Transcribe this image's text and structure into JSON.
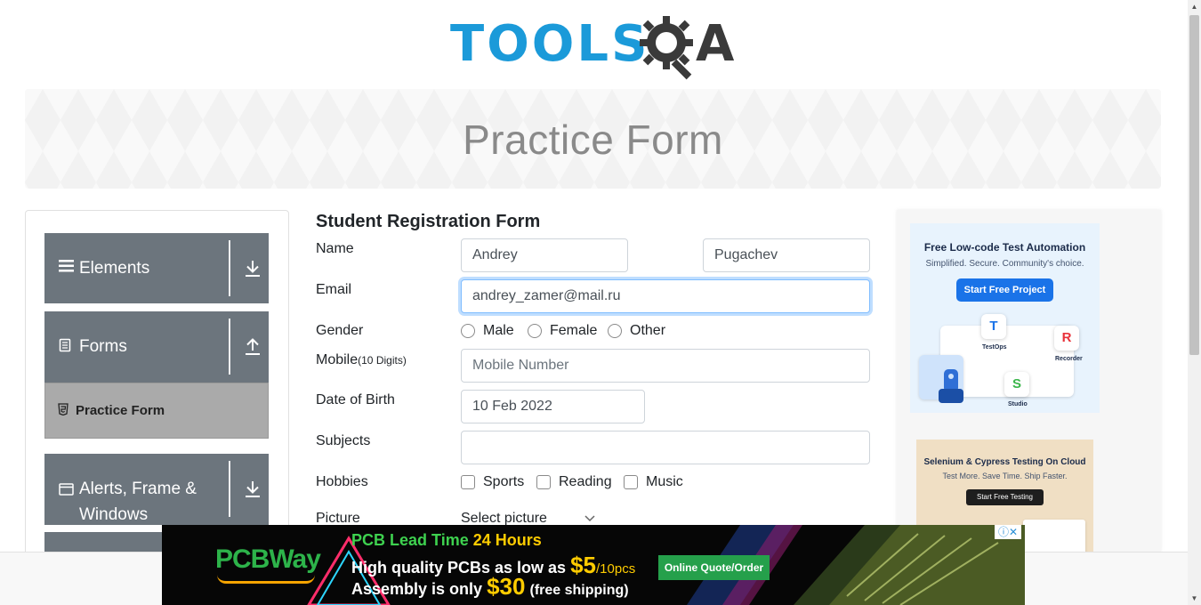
{
  "logo": {
    "text": "TOOLS",
    "suffix": "A",
    "brand_color": "#1b9ad9",
    "accent_color": "#3a3a3a"
  },
  "banner": {
    "title": "Practice Form"
  },
  "sidebar": {
    "groups": [
      {
        "label": "Elements",
        "icon": "hamburger-icon",
        "arrow": "download-icon"
      },
      {
        "label": "Forms",
        "icon": "document-icon",
        "arrow": "upload-icon"
      },
      {
        "label": "Alerts, Frame &",
        "label2": "Windows",
        "icon": "window-icon",
        "arrow": "download-icon"
      }
    ],
    "sub_item": {
      "label": "Practice Form",
      "icon": "html5-icon"
    },
    "group_bg": "#6c757d",
    "active_bg": "#aaaaaa"
  },
  "form": {
    "title": "Student Registration Form",
    "name_label": "Name",
    "first_name": "Andrey",
    "last_name": "Pugachev",
    "email_label": "Email",
    "email": "andrey_zamer@mail.ru",
    "gender_label": "Gender",
    "gender_options": [
      "Male",
      "Female",
      "Other"
    ],
    "mobile_label": "Mobile",
    "mobile_hint": "(10 Digits)",
    "mobile_placeholder": "Mobile Number",
    "dob_label": "Date of Birth",
    "dob": "10 Feb 2022",
    "subjects_label": "Subjects",
    "subjects": "",
    "hobbies_label": "Hobbies",
    "hobbies": [
      "Sports",
      "Reading",
      "Music"
    ],
    "picture_label": "Picture",
    "picture_button": "Select picture"
  },
  "ads": {
    "ad1": {
      "title": "Free Low-code Test Automation",
      "subtitle": "Simplified. Secure. Community's choice.",
      "button": "Start Free Project",
      "tiles": [
        "TestOps",
        "Recorder",
        "Studio"
      ]
    },
    "ad2": {
      "title": "Selenium & Cypress Testing On Cloud",
      "subtitle": "Test More. Save Time. Ship Faster.",
      "button": "Start Free Testing"
    },
    "pcb": {
      "brand": "PCBWay",
      "line1_a": "PCB Lead Time",
      "line1_b": "24 Hours",
      "line2_a": "High quality PCBs as low as",
      "line2_price": "$5",
      "line2_unit": "/10pcs",
      "line3_a": "Assembly is only",
      "line3_price": "$30",
      "line3_b": "(free shipping)",
      "button": "Online Quote/Order",
      "adchoices": "ⓘ✕"
    }
  }
}
